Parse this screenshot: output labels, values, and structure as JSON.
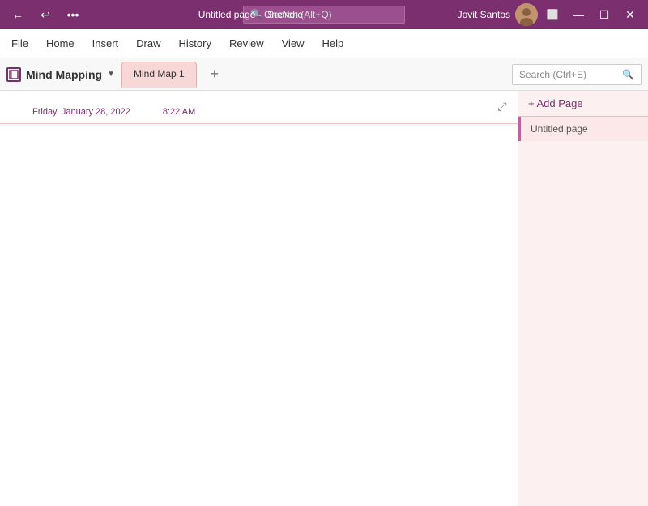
{
  "titlebar": {
    "back_label": "←",
    "undo_label": "↩",
    "pin_label": "📌",
    "title": "Untitled page - OneNote",
    "search_placeholder": "Search (Alt+Q)",
    "user_name": "Jovit Santos",
    "btn_restore": "❐",
    "btn_minimize": "—",
    "btn_maximize": "☐",
    "btn_close": "✕",
    "btn_share": "⬜"
  },
  "menubar": {
    "items": [
      "File",
      "Home",
      "Insert",
      "Draw",
      "History",
      "Review",
      "View",
      "Help"
    ]
  },
  "notebookbar": {
    "notebook_icon": "☐",
    "notebook_name": "Mind Mapping",
    "dropdown_icon": "▼",
    "active_tab": "Mind Map 1",
    "add_tab_label": "+",
    "search_placeholder": "Search (Ctrl+E)",
    "search_icon": "🔍"
  },
  "page": {
    "expand_icon": "⤢",
    "date": "Friday, January 28, 2022",
    "time": "8:22 AM",
    "content": ""
  },
  "sidebar": {
    "add_page_label": "+ Add Page",
    "pages": [
      {
        "label": "Untitled page",
        "active": true
      }
    ]
  }
}
